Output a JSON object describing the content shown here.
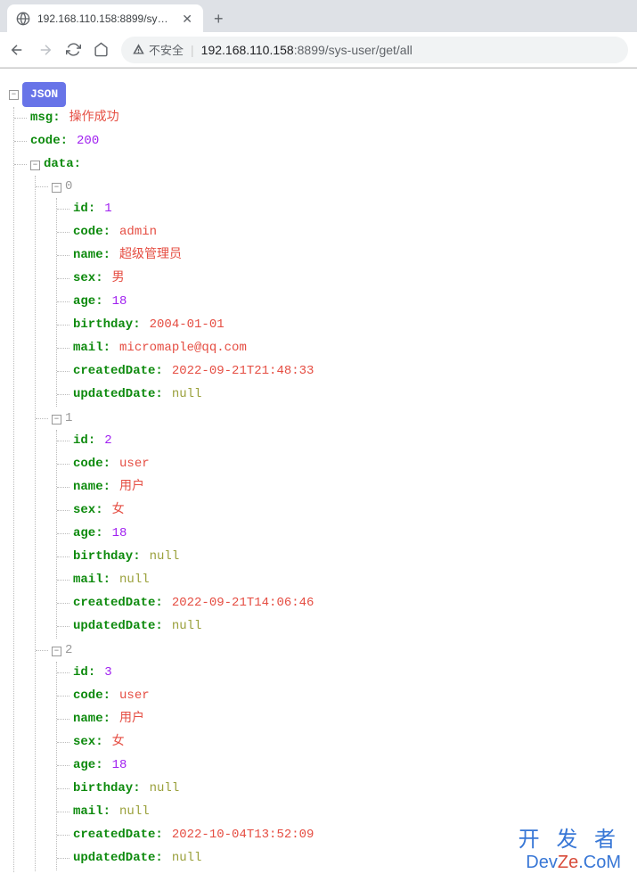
{
  "browser": {
    "tab_title": "192.168.110.158:8899/sys-use",
    "security_label": "不安全",
    "url_host": "192.168.110.158",
    "url_port": ":8899",
    "url_path": "/sys-user/get/all"
  },
  "json_label": "JSON",
  "response": {
    "msg_key": "msg",
    "msg_val": "操作成功",
    "code_key": "code",
    "code_val": "200",
    "data_key": "data",
    "items": [
      {
        "index": "0",
        "fields": [
          {
            "key": "id",
            "val": "1",
            "type": "number"
          },
          {
            "key": "code",
            "val": "admin",
            "type": "string"
          },
          {
            "key": "name",
            "val": "超级管理员",
            "type": "string"
          },
          {
            "key": "sex",
            "val": "男",
            "type": "string"
          },
          {
            "key": "age",
            "val": "18",
            "type": "number"
          },
          {
            "key": "birthday",
            "val": "2004-01-01",
            "type": "string"
          },
          {
            "key": "mail",
            "val": "micromaple@qq.com",
            "type": "string"
          },
          {
            "key": "createdDate",
            "val": "2022-09-21T21:48:33",
            "type": "string"
          },
          {
            "key": "updatedDate",
            "val": "null",
            "type": "null"
          }
        ]
      },
      {
        "index": "1",
        "fields": [
          {
            "key": "id",
            "val": "2",
            "type": "number"
          },
          {
            "key": "code",
            "val": "user",
            "type": "string"
          },
          {
            "key": "name",
            "val": "用户",
            "type": "string"
          },
          {
            "key": "sex",
            "val": "女",
            "type": "string"
          },
          {
            "key": "age",
            "val": "18",
            "type": "number"
          },
          {
            "key": "birthday",
            "val": "null",
            "type": "null"
          },
          {
            "key": "mail",
            "val": "null",
            "type": "null"
          },
          {
            "key": "createdDate",
            "val": "2022-09-21T14:06:46",
            "type": "string"
          },
          {
            "key": "updatedDate",
            "val": "null",
            "type": "null"
          }
        ]
      },
      {
        "index": "2",
        "fields": [
          {
            "key": "id",
            "val": "3",
            "type": "number"
          },
          {
            "key": "code",
            "val": "user",
            "type": "string"
          },
          {
            "key": "name",
            "val": "用户",
            "type": "string"
          },
          {
            "key": "sex",
            "val": "女",
            "type": "string"
          },
          {
            "key": "age",
            "val": "18",
            "type": "number"
          },
          {
            "key": "birthday",
            "val": "null",
            "type": "null"
          },
          {
            "key": "mail",
            "val": "null",
            "type": "null"
          },
          {
            "key": "createdDate",
            "val": "2022-10-04T13:52:09",
            "type": "string"
          },
          {
            "key": "updatedDate",
            "val": "null",
            "type": "null"
          }
        ]
      }
    ]
  },
  "watermark": {
    "line1": "开 发 者",
    "line2a": "Dev",
    "line2b": "Ze",
    "line2c": ".CoM"
  }
}
